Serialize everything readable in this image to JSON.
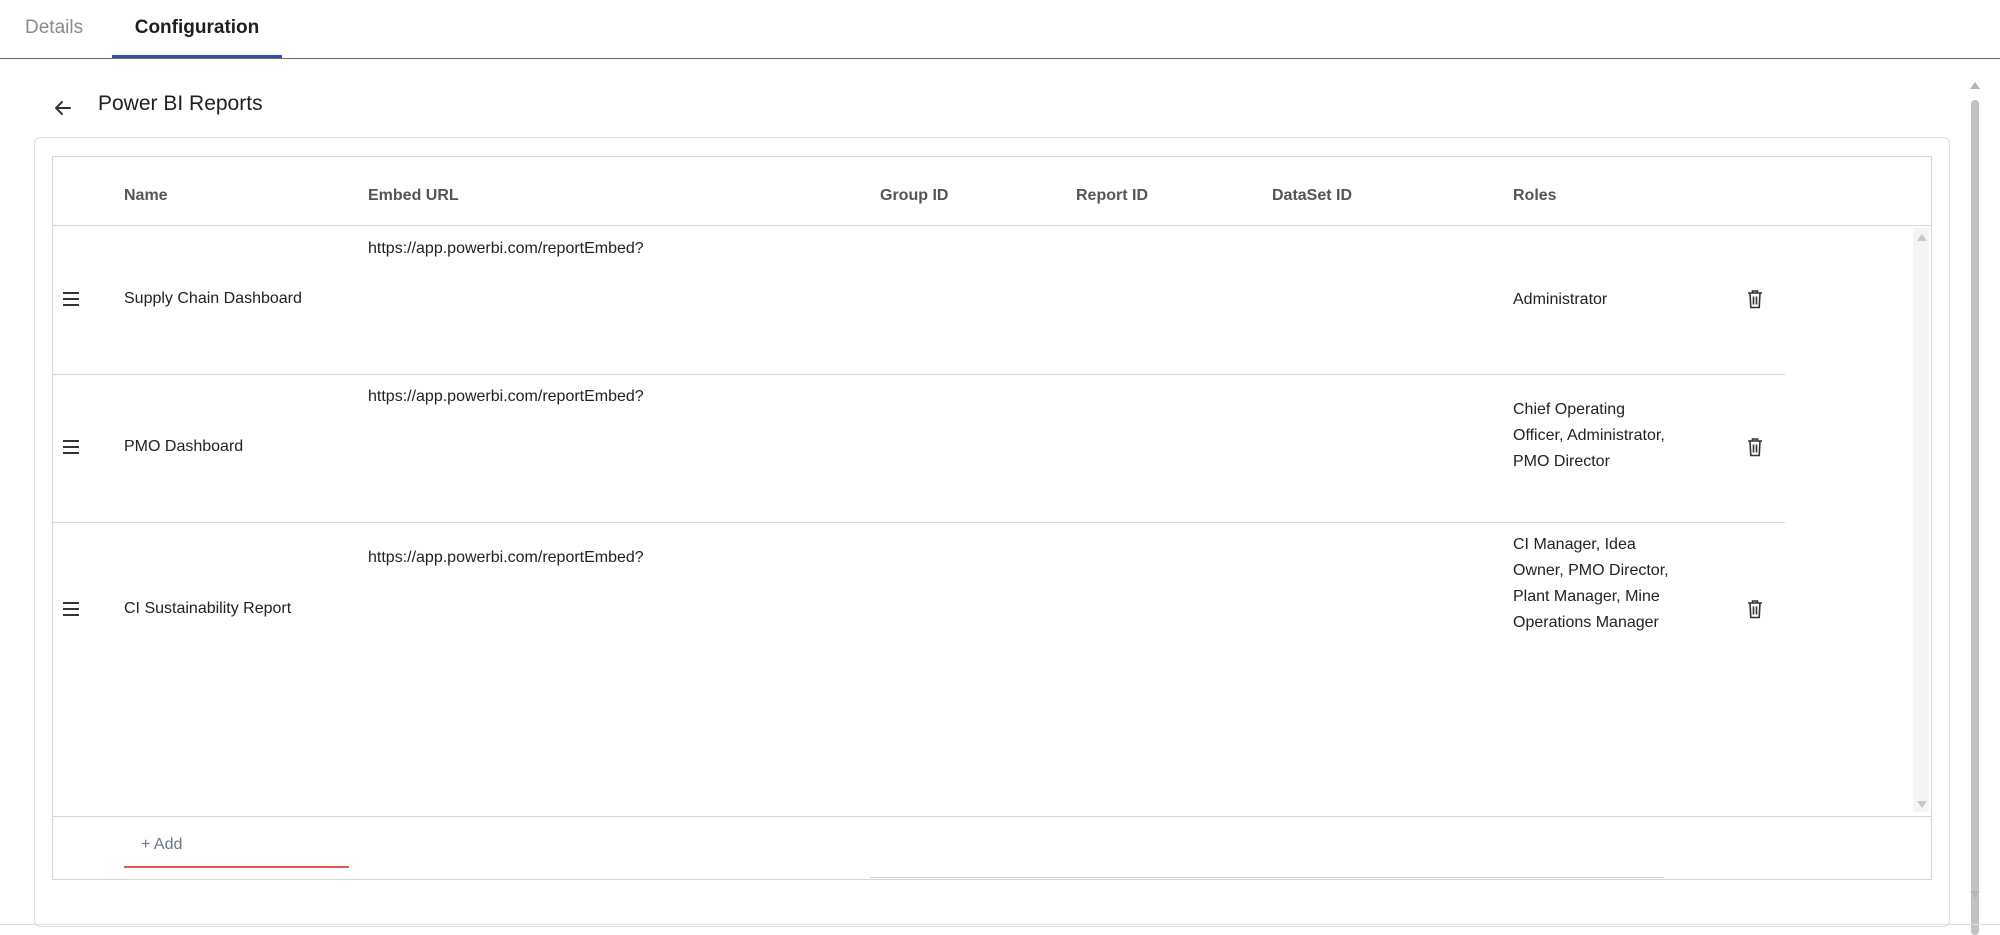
{
  "tabs": [
    {
      "label": "Details",
      "active": false
    },
    {
      "label": "Configuration",
      "active": true
    }
  ],
  "page": {
    "title": "Power BI Reports",
    "back_icon": "arrow-left-icon"
  },
  "table": {
    "columns": [
      "Name",
      "Embed URL",
      "Group ID",
      "Report ID",
      "DataSet ID",
      "Roles"
    ],
    "rows": [
      {
        "name": "Supply Chain Dashboard",
        "embed_url": "https://app.powerbi.com/reportEmbed?",
        "group_id": "",
        "report_id": "",
        "dataset_id": "",
        "roles": "Administrator"
      },
      {
        "name": "PMO Dashboard",
        "embed_url": "https://app.powerbi.com/reportEmbed?",
        "group_id": "",
        "report_id": "",
        "dataset_id": "",
        "roles": "Chief Operating Officer, Administrator, PMO Director"
      },
      {
        "name": "CI Sustainability Report",
        "embed_url": "https://app.powerbi.com/reportEmbed?",
        "group_id": "",
        "report_id": "",
        "dataset_id": "",
        "roles": "CI Manager, Idea Owner, PMO Director, Plant Manager, Mine Operations Manager"
      }
    ],
    "row_icons": {
      "drag": "drag-handle-icon",
      "delete": "trash-icon"
    }
  },
  "add_button": {
    "label": "+ Add"
  },
  "colors": {
    "active_tab_underline": "#2f4fb0",
    "add_underline": "#e05a4e",
    "header_text": "#555555"
  }
}
